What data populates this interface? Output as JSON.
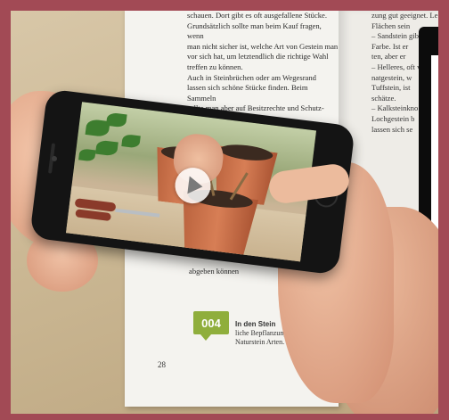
{
  "book": {
    "left_column_text": "schauen. Dort gibt es oft ausgefallene Stücke.\nGrundsätzlich sollte man beim Kauf fragen, wenn\nman nicht sicher ist, welche Art von Gestein man\nvor sich hat, um letztendlich die richtige Wahl\ntreffen zu können.\nAuch in Steinbrüchen oder am Wegesrand\nlassen sich schöne Stücke finden. Beim Sammeln\nsollte man aber auf Besitzrechte und Schutz-\nbestimmungen achten.\nScharfkantige gebrochene Felsen mit besonders\n...sehen recht urtümlich aus. Ab-\n...rode Ruhe",
    "right_column_text": "zung gut geeignet. Le\nFlächen sein\n– Sandstein gib\nFarbe. Ist er\nten, aber er\n– Helleres, oft v\nnatgestein, w\nTuffstein, ist\nschätze.\n– Kalksteinkno\nLochgestein b\nlassen sich se",
    "bottom_text": "abgeben können",
    "hint": {
      "code": "004",
      "title": "In den Stein",
      "body": "liche Bepflanzung\nNaturstein Arten."
    },
    "page_number": "28"
  },
  "phone": {
    "video_state": "paused"
  },
  "colors": {
    "frame": "#a24a55",
    "hint_green": "#8fae3c",
    "phone_body": "#141414",
    "pot_terracotta": "#c96e47"
  }
}
